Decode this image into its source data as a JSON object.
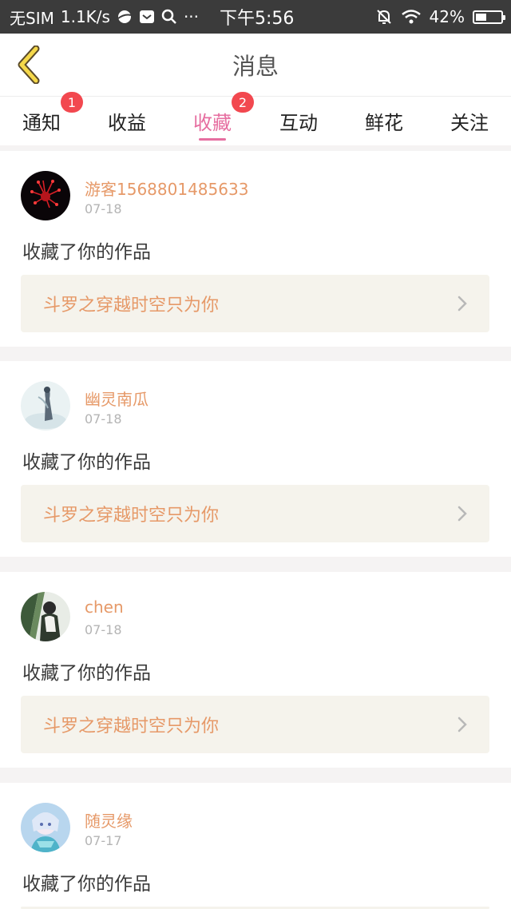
{
  "status_bar": {
    "carrier": "无SIM",
    "speed": "1.1K/s",
    "more": "···",
    "time": "下午5:56",
    "battery": "42%",
    "battery_level": 0.42
  },
  "header": {
    "title": "消息"
  },
  "tabs": [
    {
      "label": "通知",
      "badge": "1",
      "active": false
    },
    {
      "label": "收益",
      "badge": "",
      "active": false
    },
    {
      "label": "收藏",
      "badge": "2",
      "active": true
    },
    {
      "label": "互动",
      "badge": "",
      "active": false
    },
    {
      "label": "鲜花",
      "badge": "",
      "active": false
    },
    {
      "label": "关注",
      "badge": "",
      "active": false
    }
  ],
  "messages": [
    {
      "username": "游客1568801485633",
      "date": "07-18",
      "action": "收藏了你的作品",
      "work_title": "斗罗之穿越时空只为你"
    },
    {
      "username": "幽灵南瓜",
      "date": "07-18",
      "action": "收藏了你的作品",
      "work_title": "斗罗之穿越时空只为你"
    },
    {
      "username": "chen",
      "date": "07-18",
      "action": "收藏了你的作品",
      "work_title": "斗罗之穿越时空只为你"
    },
    {
      "username": "随灵缘",
      "date": "07-17",
      "action": "收藏了你的作品",
      "work_title": ""
    }
  ],
  "colors": {
    "accent_pink": "#e66ea0",
    "username_orange": "#e69968",
    "badge_red": "#f2484f"
  }
}
